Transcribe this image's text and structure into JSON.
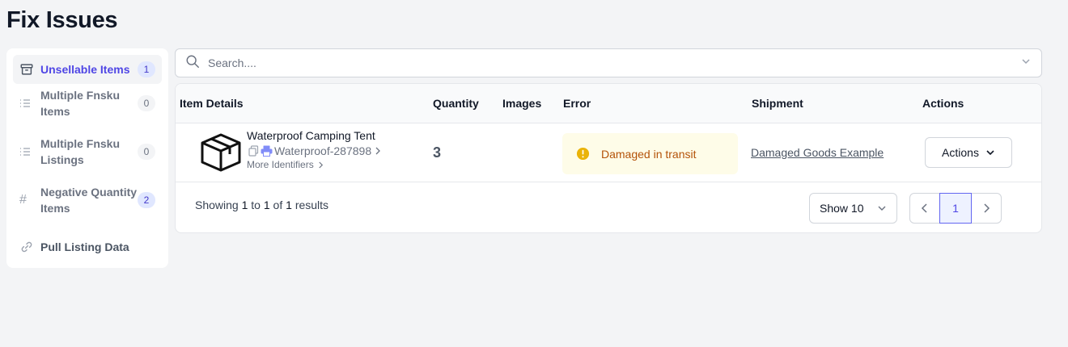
{
  "page": {
    "title": "Fix Issues"
  },
  "sidebar": {
    "items": [
      {
        "label": "Unsellable Items",
        "count": "1",
        "icon": "archive-icon"
      },
      {
        "label": "Multiple Fnsku Items",
        "count": "0",
        "icon": "list-icon"
      },
      {
        "label": "Multiple Fnsku Listings",
        "count": "0",
        "icon": "list-icon"
      },
      {
        "label": "Negative Quantity Items",
        "count": "2",
        "icon": "hash-icon"
      },
      {
        "label": "Pull Listing Data",
        "icon": "link-icon"
      }
    ]
  },
  "search": {
    "placeholder": "Search....",
    "value": ""
  },
  "table": {
    "headers": {
      "item_details": "Item Details",
      "quantity": "Quantity",
      "images": "Images",
      "error": "Error",
      "shipment": "Shipment",
      "actions": "Actions"
    },
    "rows": [
      {
        "name": "Waterproof Camping Tent",
        "sku": "Waterproof-287898",
        "more_identifiers": "More Identifiers",
        "quantity": "3",
        "error": "Damaged in transit",
        "shipment": "Damaged Goods Example",
        "actions_label": "Actions"
      }
    ]
  },
  "footer": {
    "showing_prefix": "Showing",
    "from": "1",
    "to_word": "to",
    "to": "1",
    "of_word": "of",
    "total": "1",
    "results_word": "results",
    "page_size_label": "Show 10",
    "current_page": "1"
  },
  "colors": {
    "accent": "#4f46e5",
    "error_bg": "#fefce8",
    "error_text": "#b45309",
    "warning_icon": "#eab308"
  }
}
